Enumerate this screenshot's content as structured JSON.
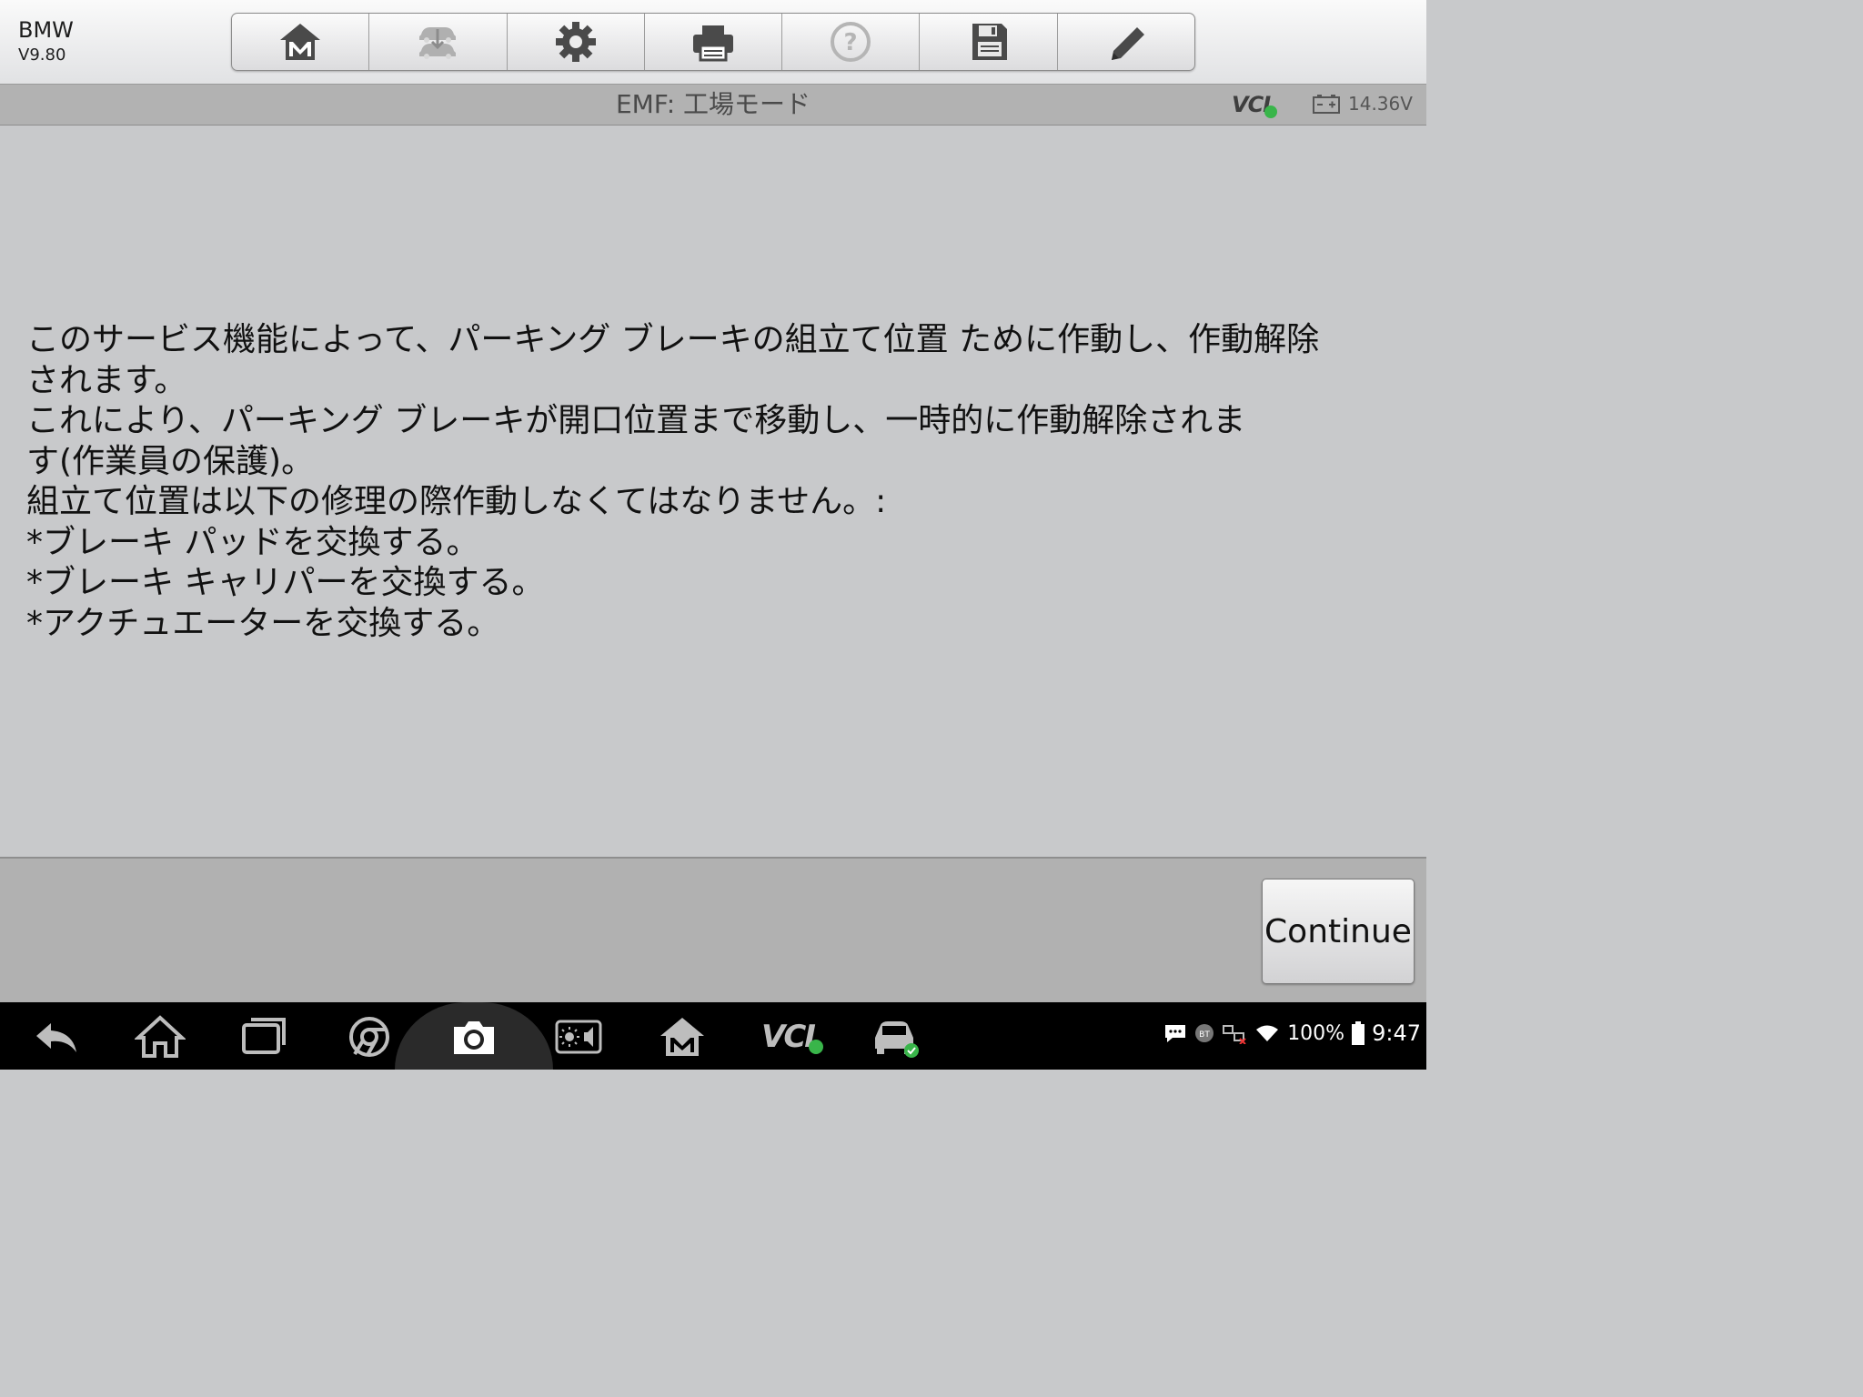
{
  "app": {
    "name": "BMW",
    "version": "V9.80"
  },
  "header": {
    "title": "EMF: 工場モード",
    "vci_label": "VCI",
    "battery_voltage": "14.36V"
  },
  "toolbar": {
    "icons": [
      "home-m-icon",
      "vehicle-swap-icon",
      "settings-gear-icon",
      "print-icon",
      "help-icon",
      "save-icon",
      "edit-pencil-icon"
    ]
  },
  "content": {
    "lines": [
      "このサービス機能によって、パーキング ブレーキの組立て位置 ために作動し、作動解除",
      "されます。",
      "これにより、パーキング ブレーキが開口位置まで移動し、一時的に作動解除されま",
      "す(作業員の保護)。",
      "組立て位置は以下の修理の際作動しなくてはなりません。:",
      "*ブレーキ パッドを交換する。",
      "*ブレーキ キャリパーを交換する。",
      "*アクチュエーターを交換する。"
    ]
  },
  "footer": {
    "continue_label": "Continue"
  },
  "statusbar": {
    "battery_percent": "100%",
    "time": "9:47",
    "nav_vci_label": "VCI"
  },
  "colors": {
    "ok_green": "#39b54a",
    "background": "#c8c9cb"
  }
}
